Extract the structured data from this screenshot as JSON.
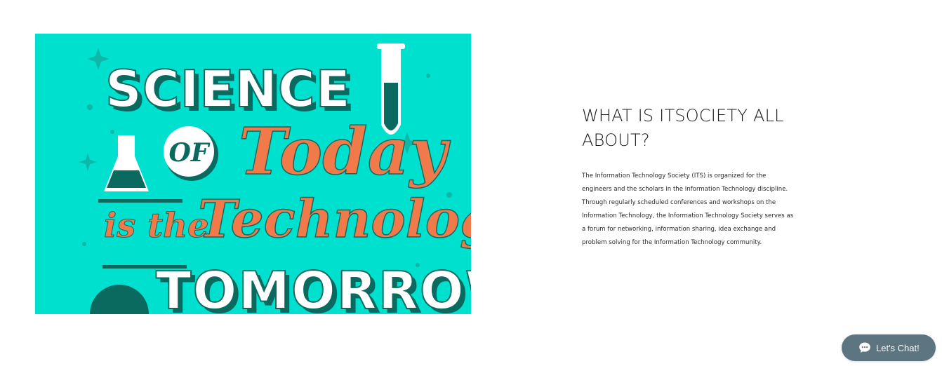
{
  "poster": {
    "line_science": "SCIENCE",
    "word_of": "OF",
    "word_today": "Today",
    "word_is_the": "is the",
    "word_technology": "Technology",
    "line_tomorrow": "TOMORROW",
    "colors": {
      "background": "#00e0cf",
      "letter_fill": "#ffffff",
      "letter_shadow": "#0b6a60",
      "script": "#f07a4a"
    }
  },
  "about": {
    "title": "WHAT IS ITSOCIETY ALL ABOUT?",
    "body": "The Information Technology Society (ITS) is organized for the engineers and the scholars in the Information Technology discipline. Through regularly scheduled conferences and workshops on the Information Technology, the Information Technology Society serves as a forum for networking, information sharing, idea exchange and problem solving for the Information Technology community."
  },
  "chat": {
    "label": "Let's Chat!",
    "icon": "chat-bubble-icon",
    "color": "#5c7580"
  }
}
